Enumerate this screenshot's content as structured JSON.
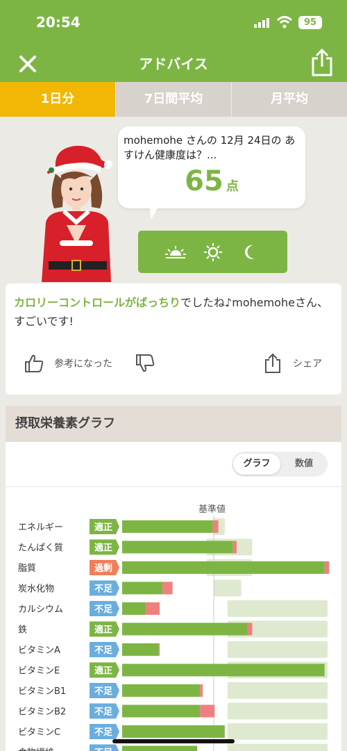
{
  "status": {
    "time": "20:54",
    "battery": "95"
  },
  "nav": {
    "title": "アドバイス",
    "close_icon": "close-icon",
    "share_icon": "share-icon"
  },
  "tabs": [
    {
      "label": "1日分",
      "active": true
    },
    {
      "label": "7日間平均",
      "active": false
    },
    {
      "label": "月平均",
      "active": false
    }
  ],
  "bubble": {
    "question": "mohemohe さんの 12月 24日の あすけん健康度は？...",
    "score": "65",
    "unit": "点"
  },
  "time_icons": [
    "sunrise-icon",
    "sun-icon",
    "moon-icon"
  ],
  "advice": {
    "highlight": "カロリーコントロールがばっちり",
    "rest": "でしたね♪mohemoheさん、すごいです!"
  },
  "actions": {
    "helpful": "参考になった",
    "share": "シェア"
  },
  "graph": {
    "title": "摂取栄養素グラフ",
    "toggle": {
      "graph": "グラフ",
      "values": "数値"
    }
  },
  "colors": {
    "green": "#7db544",
    "over": "#ef7f5a",
    "under": "#6aaede",
    "excess": "#f08080",
    "range": "#dfe9cf",
    "active_tab": "#f2b705"
  },
  "chart_data": {
    "type": "bar",
    "title": "摂取栄養素グラフ",
    "reference_label": "基準値",
    "status_colors": {
      "適正": "#7db544",
      "過剰": "#ef7f5a",
      "不足": "#6aaede"
    },
    "rows": [
      {
        "name": "エネルギー",
        "status": "適正",
        "value": 0.99,
        "excess": 0.06,
        "range": [
          0.99,
          1.12
        ]
      },
      {
        "name": "たんぱく質",
        "status": "適正",
        "value": 1.21,
        "excess": 0.04,
        "range": [
          0.92,
          1.42
        ]
      },
      {
        "name": "脂質",
        "status": "過剰",
        "value": 2.21,
        "excess": 0.05,
        "range": [
          0.92,
          1.42
        ]
      },
      {
        "name": "炭水化物",
        "status": "不足",
        "value": 0.44,
        "excess": 0.11,
        "range": [
          1.0,
          1.3
        ]
      },
      {
        "name": "カルシウム",
        "status": "不足",
        "value": 0.26,
        "excess": 0.15,
        "range": [
          1.15,
          2.33
        ]
      },
      {
        "name": "鉄",
        "status": "適正",
        "value": 1.37,
        "excess": 0.05,
        "range": [
          1.15,
          2.33
        ]
      },
      {
        "name": "ビタミンA",
        "status": "不足",
        "value": 0.4,
        "excess": 0.01,
        "range": [
          1.15,
          2.33
        ]
      },
      {
        "name": "ビタミンE",
        "status": "適正",
        "value": 2.21,
        "excess": 0.0,
        "range": [
          1.15,
          2.33
        ]
      },
      {
        "name": "ビタミンB1",
        "status": "不足",
        "value": 0.85,
        "excess": 0.03,
        "range": [
          1.15,
          2.33
        ]
      },
      {
        "name": "ビタミンB2",
        "status": "不足",
        "value": 0.85,
        "excess": 0.16,
        "range": [
          1.15,
          2.33
        ]
      },
      {
        "name": "ビタミンC",
        "status": "不足",
        "value": 1.12,
        "excess": 0.0,
        "range": [
          1.15,
          2.33
        ]
      },
      {
        "name": "食物繊維",
        "status": "不足",
        "value": 0.82,
        "excess": 0.0,
        "range": [
          1.15,
          2.33
        ]
      }
    ]
  }
}
